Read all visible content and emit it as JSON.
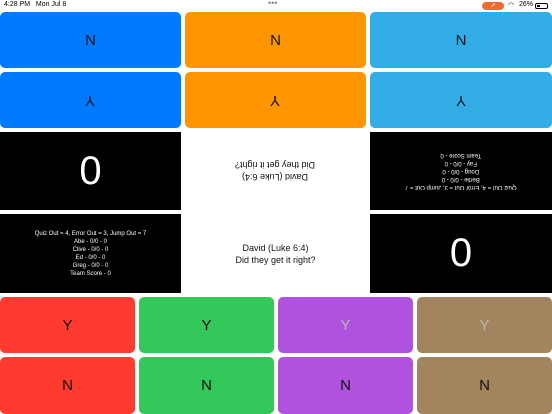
{
  "status_bar": {
    "time": "4:28 PM",
    "date": "Mon Jul 8",
    "dots": "•••",
    "battery": "26%"
  },
  "top_buttons": {
    "no_label": "N",
    "yes_label": "Y"
  },
  "bottom_buttons": {
    "no_label": "N",
    "yes_label": "Y"
  },
  "top_team": {
    "score": "0",
    "status_lines": [
      "Quiz Out = 4, Error Out = 3, Jump Out = 7",
      "Bertie - 0/0 - 0",
      "Doug - 0/0 - 0",
      "Fay - 0/0 - 0",
      "Team Score - 0"
    ]
  },
  "bottom_team": {
    "score": "0",
    "status_lines": [
      "Quiz Out = 4, Error Out = 3, Jump Out = 7",
      "Abe - 0/0 - 0",
      "Clive  - 0/0 - 0",
      "Ed - 0/0 - 0",
      "Greg  - 0/0 - 0",
      "Team Score - 0"
    ]
  },
  "question": {
    "quizzer": "David (Luke 6:4)",
    "prompt": "Did they get it right?"
  },
  "colors": {
    "blue": "#007aff",
    "orange": "#ff9500",
    "light_blue": "#32ade6",
    "red": "#ff3b30",
    "green": "#34c759",
    "purple": "#af52de",
    "brown": "#a2845e"
  }
}
